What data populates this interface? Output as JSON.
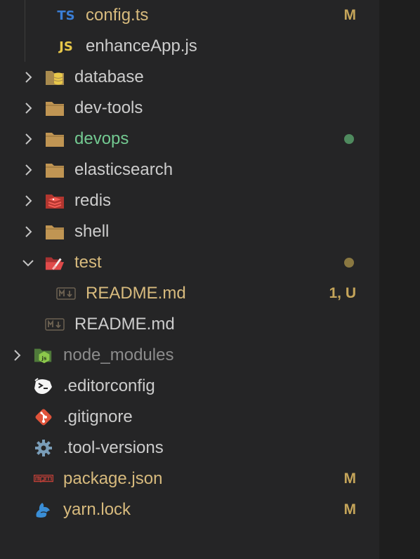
{
  "explorer": {
    "rows": [
      {
        "name": "config.ts",
        "badge": "M",
        "icon": "typescript-icon"
      },
      {
        "name": "enhanceApp.js",
        "icon": "javascript-icon"
      },
      {
        "name": "database",
        "icon": "folder-database-icon"
      },
      {
        "name": "dev-tools",
        "icon": "folder-icon"
      },
      {
        "name": "devops",
        "icon": "folder-icon"
      },
      {
        "name": "elasticsearch",
        "icon": "folder-icon"
      },
      {
        "name": "redis",
        "icon": "folder-redis-icon"
      },
      {
        "name": "shell",
        "icon": "folder-icon"
      },
      {
        "name": "test",
        "icon": "folder-test-open-icon"
      },
      {
        "name": "README.md",
        "badge": "1, U",
        "icon": "markdown-icon"
      },
      {
        "name": "README.md",
        "icon": "markdown-icon"
      },
      {
        "name": "node_modules",
        "icon": "folder-node-icon"
      },
      {
        "name": ".editorconfig",
        "icon": "editorconfig-icon"
      },
      {
        "name": ".gitignore",
        "icon": "git-icon"
      },
      {
        "name": ".tool-versions",
        "icon": "gear-icon"
      },
      {
        "name": "package.json",
        "badge": "M",
        "icon": "npm-icon"
      },
      {
        "name": "yarn.lock",
        "badge": "M",
        "icon": "yarn-icon"
      }
    ],
    "icon_labels": {
      "ts": "TS",
      "js": "JS"
    }
  },
  "colors": {
    "background": "#252526",
    "text": "#cccccc",
    "modified": "#d7ba7d",
    "untracked_green": "#73c991",
    "ignored": "#8c8c8c",
    "folder": "#c09553"
  }
}
